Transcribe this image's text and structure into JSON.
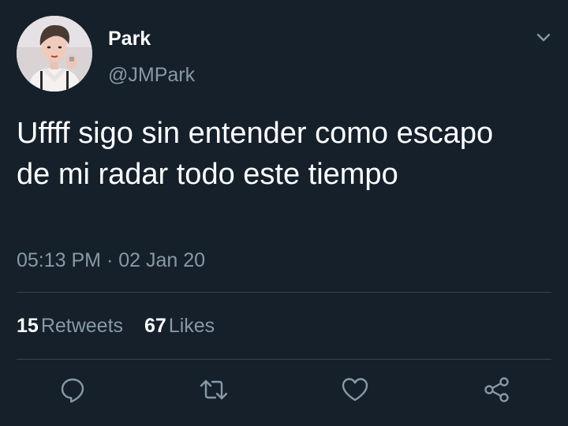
{
  "tweet": {
    "author": {
      "display_name": "Park",
      "handle": "@JMPark"
    },
    "text": "Uffff sigo sin entender como escapo de mi radar todo este tiempo",
    "time": "05:13 PM",
    "separator": "·",
    "date": "02 Jan 20",
    "stats": {
      "retweets_count": "15",
      "retweets_label": "Retweets",
      "likes_count": "67",
      "likes_label": "Likes"
    }
  },
  "icons": {
    "menu": "chevron-down-icon",
    "reply": "reply-icon",
    "retweet": "retweet-icon",
    "like": "heart-icon",
    "share": "share-icon"
  },
  "colors": {
    "background": "#15202b",
    "primary_text": "#ffffff",
    "secondary_text": "#8899a6",
    "divider": "#38444d"
  }
}
